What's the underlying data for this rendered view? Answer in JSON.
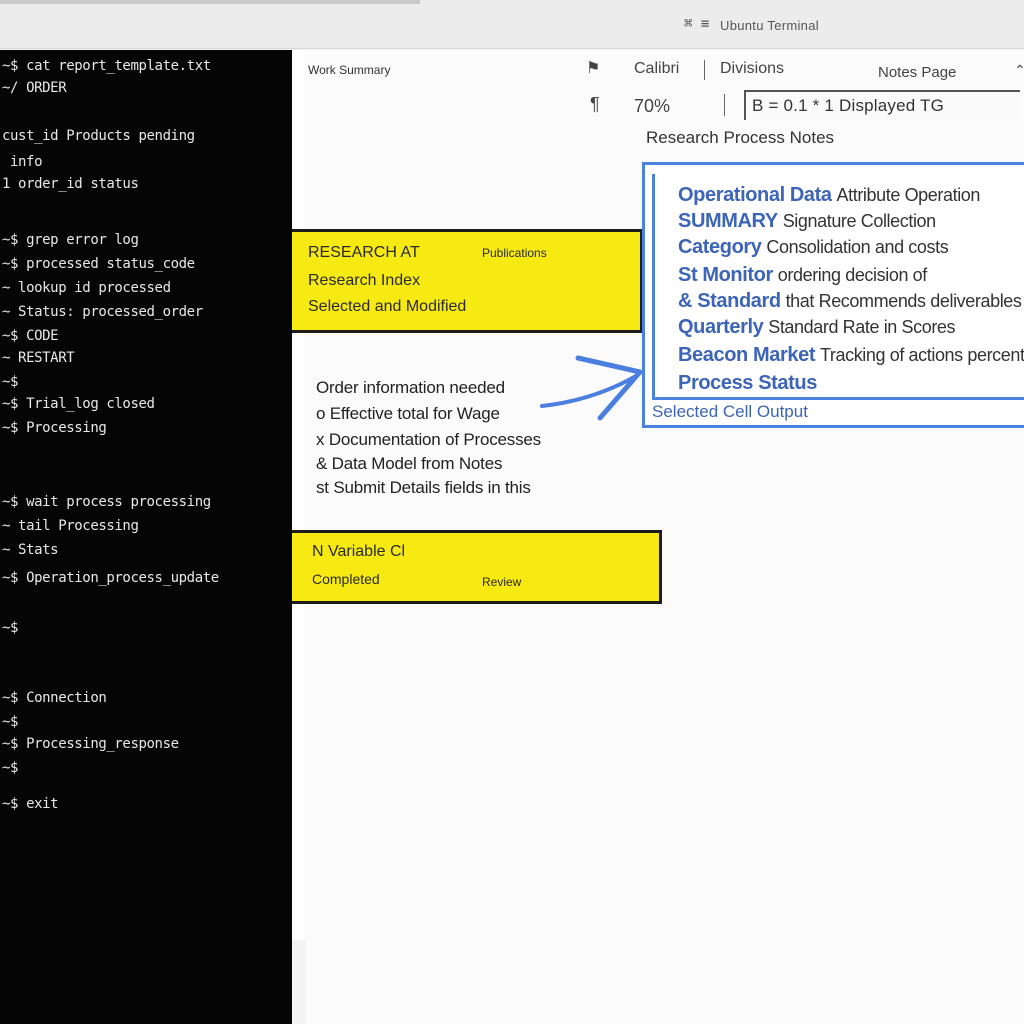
{
  "window": {
    "icon": "⌘ ≡",
    "title": "Ubuntu Terminal"
  },
  "terminal": {
    "lines": [
      "~$ cat report_template.txt",
      "~/ ORDER",
      "  cust_id Products pending",
      "  info",
      "1  order_id status",
      "~$ grep error log",
      "~$ processed  status_code",
      "~  lookup id   processed",
      "~  Status: processed_order",
      "~$ CODE",
      "~ RESTART",
      "~$",
      "~$  Trial_log closed",
      "~$  Processing",
      "~$  wait  process  processing",
      "~  tail Processing",
      "~ Stats",
      "~$  Operation_process_update",
      "~$",
      "~$  Connection",
      "~$",
      "~$  Processing_response",
      "~$",
      "~$ exit"
    ]
  },
  "document": {
    "header_label": "Work Summary",
    "toolbar": {
      "font_name": "Calibri",
      "style_name": "Divisions",
      "view_label": "Notes Page",
      "zoom": "70%",
      "formula": "B = 0.1 * 1 Displayed TG"
    },
    "section_label": "Research Process Notes",
    "callout_1": {
      "line1": "RESEARCH AT",
      "line1b": "Publications",
      "line2": "Research Index",
      "line3": "Selected and Modified"
    },
    "note": {
      "lines": [
        "Order information needed",
        "o Effective total for Wage",
        "x Documentation of Processes",
        "& Data Model from Notes",
        "st Submit Details fields in this"
      ]
    },
    "callout_2": {
      "line1": "N Variable Cl",
      "line2": "Completed",
      "badge": "Review"
    },
    "selection": {
      "rows": [
        {
          "bold": "Operational Data",
          "rest": "Attribute Operation"
        },
        {
          "bold": "SUMMARY",
          "rest": "Signature Collection"
        },
        {
          "bold": "Category",
          "rest": "Consolidation and costs"
        },
        {
          "bold": "St Monitor",
          "rest": "ordering decision of"
        },
        {
          "bold": "& Standard",
          "rest": "that Recommends deliverables"
        },
        {
          "bold": "Quarterly",
          "rest": "Standard Rate in Scores"
        },
        {
          "bold": "Beacon Market",
          "rest": "Tracking of actions percent"
        },
        {
          "bold": "Process Status",
          "rest": ""
        }
      ],
      "caption": "Selected Cell Output"
    }
  },
  "colors": {
    "terminal_bg": "#050505",
    "callout_yellow": "#f7ea12",
    "selection_blue": "#4a82e0"
  }
}
